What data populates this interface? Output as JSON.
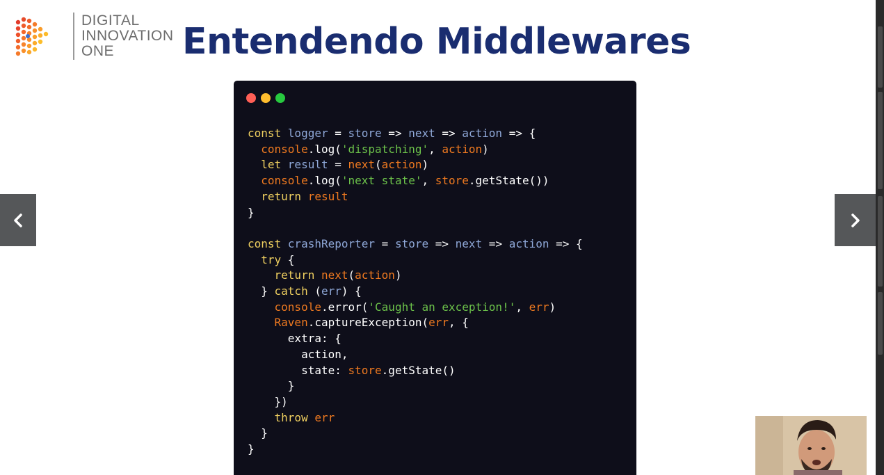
{
  "brand": {
    "name_lines": [
      "DIGITAL",
      "INNOVATION",
      "ONE"
    ]
  },
  "slide": {
    "title": "Entendendo Middlewares"
  },
  "code": {
    "lines": [
      [
        [
          "kw",
          "const "
        ],
        [
          "def",
          "logger"
        ],
        [
          "plain",
          " = "
        ],
        [
          "def",
          "store"
        ],
        [
          "plain",
          " => "
        ],
        [
          "def",
          "next"
        ],
        [
          "plain",
          " => "
        ],
        [
          "def",
          "action"
        ],
        [
          "plain",
          " => {"
        ]
      ],
      [
        [
          "plain",
          "  "
        ],
        [
          "fn",
          "console"
        ],
        [
          "plain",
          ".log("
        ],
        [
          "str",
          "'dispatching'"
        ],
        [
          "plain",
          ", "
        ],
        [
          "fn",
          "action"
        ],
        [
          "plain",
          ")"
        ]
      ],
      [
        [
          "plain",
          "  "
        ],
        [
          "kw",
          "let "
        ],
        [
          "def",
          "result"
        ],
        [
          "plain",
          " = "
        ],
        [
          "fn",
          "next"
        ],
        [
          "plain",
          "("
        ],
        [
          "fn",
          "action"
        ],
        [
          "plain",
          ")"
        ]
      ],
      [
        [
          "plain",
          "  "
        ],
        [
          "fn",
          "console"
        ],
        [
          "plain",
          ".log("
        ],
        [
          "str",
          "'next state'"
        ],
        [
          "plain",
          ", "
        ],
        [
          "fn",
          "store"
        ],
        [
          "plain",
          ".getState())"
        ]
      ],
      [
        [
          "plain",
          "  "
        ],
        [
          "kw",
          "return "
        ],
        [
          "fn",
          "result"
        ]
      ],
      [
        [
          "plain",
          "}"
        ]
      ],
      [
        [
          "plain",
          ""
        ]
      ],
      [
        [
          "kw",
          "const "
        ],
        [
          "def",
          "crashReporter"
        ],
        [
          "plain",
          " = "
        ],
        [
          "def",
          "store"
        ],
        [
          "plain",
          " => "
        ],
        [
          "def",
          "next"
        ],
        [
          "plain",
          " => "
        ],
        [
          "def",
          "action"
        ],
        [
          "plain",
          " => {"
        ]
      ],
      [
        [
          "plain",
          "  "
        ],
        [
          "kw",
          "try"
        ],
        [
          "plain",
          " {"
        ]
      ],
      [
        [
          "plain",
          "    "
        ],
        [
          "kw",
          "return "
        ],
        [
          "fn",
          "next"
        ],
        [
          "plain",
          "("
        ],
        [
          "fn",
          "action"
        ],
        [
          "plain",
          ")"
        ]
      ],
      [
        [
          "plain",
          "  } "
        ],
        [
          "kw",
          "catch"
        ],
        [
          "plain",
          " ("
        ],
        [
          "def",
          "err"
        ],
        [
          "plain",
          ") {"
        ]
      ],
      [
        [
          "plain",
          "    "
        ],
        [
          "fn",
          "console"
        ],
        [
          "plain",
          ".error("
        ],
        [
          "str",
          "'Caught an exception!'"
        ],
        [
          "plain",
          ", "
        ],
        [
          "fn",
          "err"
        ],
        [
          "plain",
          ")"
        ]
      ],
      [
        [
          "plain",
          "    "
        ],
        [
          "fn",
          "Raven"
        ],
        [
          "plain",
          ".captureException("
        ],
        [
          "fn",
          "err"
        ],
        [
          "plain",
          ", {"
        ]
      ],
      [
        [
          "plain",
          "      extra: {"
        ]
      ],
      [
        [
          "plain",
          "        action,"
        ]
      ],
      [
        [
          "plain",
          "        state: "
        ],
        [
          "fn",
          "store"
        ],
        [
          "plain",
          ".getState()"
        ]
      ],
      [
        [
          "plain",
          "      }"
        ]
      ],
      [
        [
          "plain",
          "    })"
        ]
      ],
      [
        [
          "plain",
          "    "
        ],
        [
          "kw",
          "throw "
        ],
        [
          "fn",
          "err"
        ]
      ],
      [
        [
          "plain",
          "  }"
        ]
      ],
      [
        [
          "plain",
          "}"
        ]
      ]
    ]
  },
  "nav": {
    "prev_icon": "chevron-left-icon",
    "next_icon": "chevron-right-icon"
  },
  "colors": {
    "title": "#1a2d70",
    "code_bg": "#0e0e1a",
    "keyword": "#f0d060",
    "identifier": "#8fa8d8",
    "function": "#f07a20",
    "string": "#6cc24a"
  }
}
